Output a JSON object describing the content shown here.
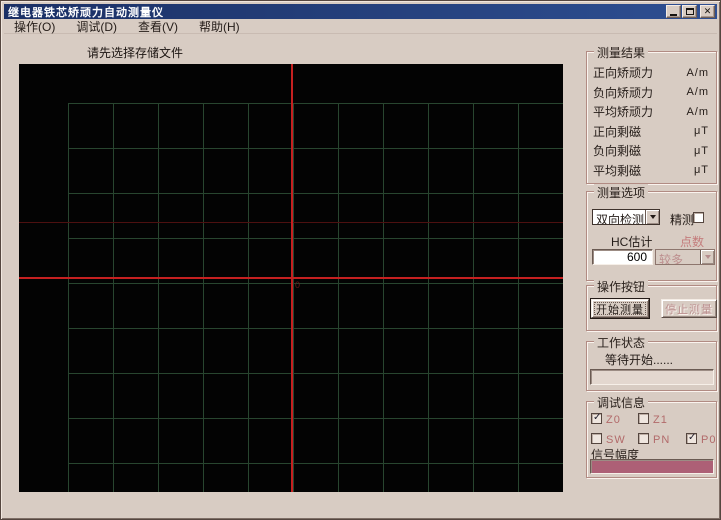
{
  "window": {
    "title": "继电器铁芯矫顽力自动测量仪",
    "controls": {
      "minimize": "min",
      "maximize": "max",
      "close": "✕"
    }
  },
  "menu": {
    "items": [
      {
        "label": "操作(O)"
      },
      {
        "label": "调试(D)"
      },
      {
        "label": "查看(V)"
      },
      {
        "label": "帮助(H)"
      }
    ]
  },
  "plot": {
    "hint": "请先选择存储文件",
    "origin_label": "0",
    "colors": {
      "background": "#030303",
      "grid": "#28452f",
      "crosshair": "#c52020",
      "faint_line": "#4d1010"
    }
  },
  "results": {
    "title": "测量结果",
    "rows": [
      {
        "label": "正向矫顽力",
        "value": "",
        "unit": "A/m"
      },
      {
        "label": "负向矫顽力",
        "value": "",
        "unit": "A/m"
      },
      {
        "label": "平均矫顽力",
        "value": "",
        "unit": "A/m"
      },
      {
        "label": "正向剩磁",
        "value": "",
        "unit": "μT"
      },
      {
        "label": "负向剩磁",
        "value": "",
        "unit": "μT"
      },
      {
        "label": "平均剩磁",
        "value": "",
        "unit": "μT"
      }
    ]
  },
  "options": {
    "title": "测量选项",
    "mode_value": "双向检测",
    "fine_label": "精测",
    "fine_checked": false,
    "hc_label": "HC估计",
    "hc_value": "600",
    "points_label": "点数",
    "points_value": "较多",
    "points_enabled": false
  },
  "actions": {
    "title": "操作按钮",
    "start_label": "开始测量",
    "stop_label": "停止测量",
    "stop_enabled": false
  },
  "status": {
    "title": "工作状态",
    "text": "等待开始......"
  },
  "debug": {
    "title": "调试信息",
    "checks": [
      {
        "label": "Z0",
        "checked": true
      },
      {
        "label": "Z1",
        "checked": false
      },
      {
        "label": "SW",
        "checked": false
      },
      {
        "label": "PN",
        "checked": false
      },
      {
        "label": "P0",
        "checked": true
      }
    ],
    "signal_label": "信号幅度",
    "signal_bar_color": "#ad6076"
  }
}
